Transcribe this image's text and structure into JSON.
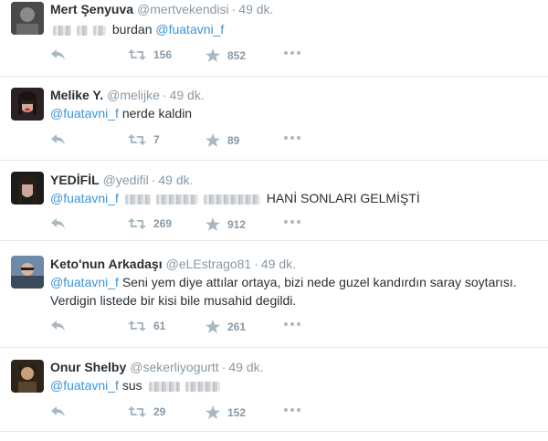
{
  "tweets": [
    {
      "name": "Mert Şenyuva",
      "handle": "@mertvekendisi",
      "time": "49 dk.",
      "text_parts": {
        "before": "",
        "mention": "",
        "after": "burdan",
        "mention2": "@fuatavni_f"
      },
      "retweets": "156",
      "favorites": "852"
    },
    {
      "name": "Melike Y.",
      "handle": "@melijke",
      "time": "49 dk.",
      "text_parts": {
        "mention": "@fuatavni_f",
        "after": "nerde kaldin"
      },
      "retweets": "7",
      "favorites": "89"
    },
    {
      "name": "YEDİFİL",
      "handle": "@yedifil",
      "time": "49 dk.",
      "text_parts": {
        "mention": "@fuatavni_f",
        "after": "HANİ SONLARI GELMİŞTİ"
      },
      "retweets": "269",
      "favorites": "912"
    },
    {
      "name": "Keto'nun Arkadaşı",
      "handle": "@eLEstrago81",
      "time": "49 dk.",
      "text_parts": {
        "mention": "@fuatavni_f",
        "after": "Seni yem diye attılar ortaya, bizi nede guzel kandırdın saray soytarısı. Verdigin listede bir kisi bile musahid degildi."
      },
      "retweets": "61",
      "favorites": "261"
    },
    {
      "name": "Onur Shelby",
      "handle": "@sekerliyogurtt",
      "time": "49 dk.",
      "text_parts": {
        "mention": "@fuatavni_f",
        "after": "sus"
      },
      "retweets": "29",
      "favorites": "152"
    }
  ],
  "separator": "·",
  "icons": [
    "reply-icon",
    "retweet-icon",
    "star-icon",
    "more-icon"
  ],
  "colors": {
    "mention": "#3b94d9",
    "meta": "#8899a6",
    "text": "#292f33",
    "divider": "#e1e8ed"
  }
}
